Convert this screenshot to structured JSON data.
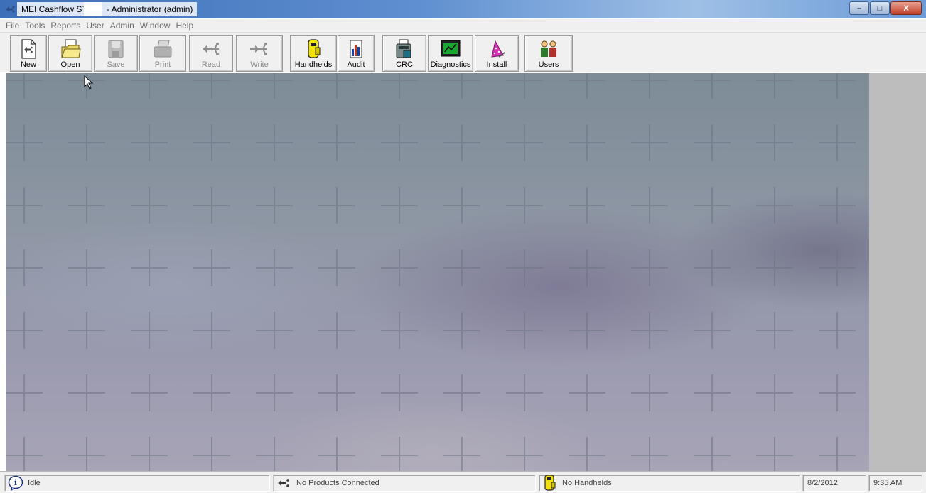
{
  "window": {
    "title_app": "MEI Cashflow STS",
    "title_user": "- Administrator (admin)",
    "minimize": "–",
    "maximize": "□",
    "close": "X"
  },
  "menu": [
    "File",
    "Tools",
    "Reports",
    "User",
    "Admin",
    "Window",
    "Help"
  ],
  "toolbar": {
    "new": "New",
    "open": "Open",
    "save": "Save",
    "print": "Print",
    "read": "Read",
    "write": "Write",
    "handhelds": "Handhelds",
    "audit": "Audit",
    "crc": "CRC",
    "diagnostics": "Diagnostics",
    "install": "Install",
    "users": "Users"
  },
  "status": {
    "state": "Idle",
    "products": "No Products Connected",
    "handhelds": "No Handhelds",
    "date": "8/2/2012",
    "time": "9:35 AM"
  },
  "colors": {
    "titlebar": "#3d6fb8",
    "toolbar_bg": "#f0f0f0",
    "disabled_text": "#8a8a8a"
  },
  "icons": {
    "app": "usb-arrows-icon",
    "status_info": "info-icon",
    "status_products": "usb-icon",
    "status_handheld": "handheld-icon"
  }
}
